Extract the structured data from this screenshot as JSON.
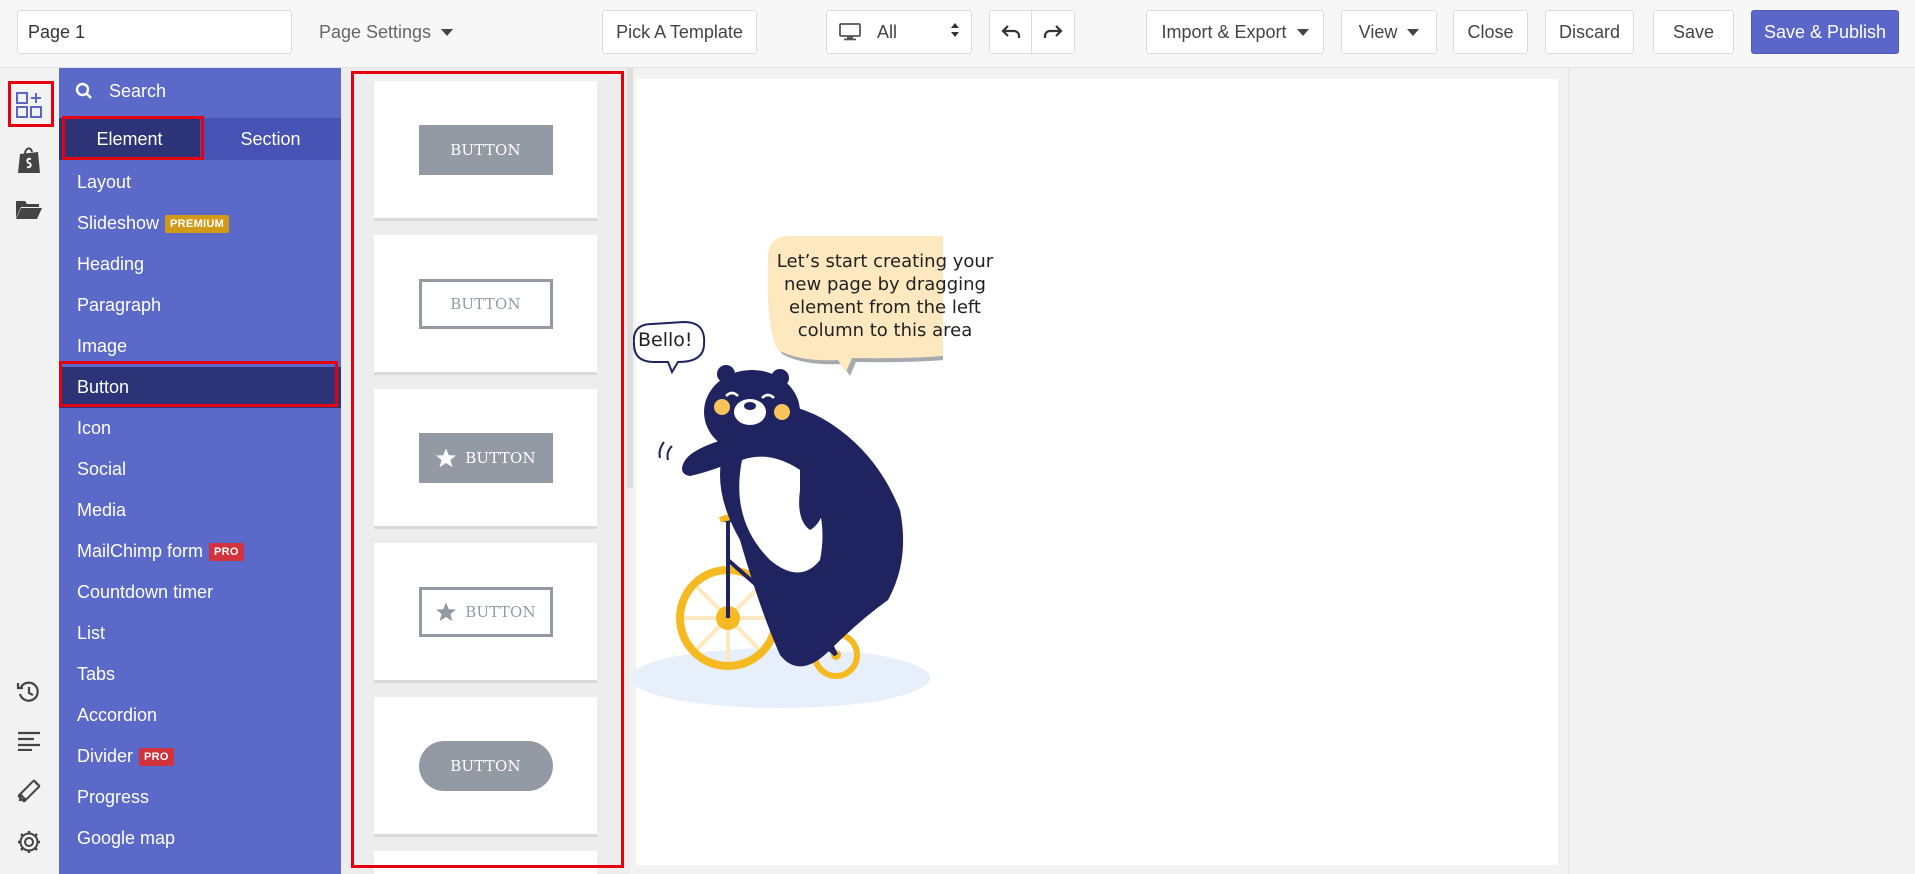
{
  "topbar": {
    "page_name": "Page 1",
    "page_settings": "Page Settings",
    "pick_template": "Pick A Template",
    "device_value": "All",
    "import_export": "Import & Export",
    "view": "View",
    "close": "Close",
    "discard": "Discard",
    "save": "Save",
    "save_publish": "Save & Publish"
  },
  "rail": {
    "icons": [
      "add-element-icon",
      "shopify-bag-icon",
      "folder-icon",
      "history-icon",
      "text-align-icon",
      "design-tools-icon",
      "settings-gear-icon"
    ]
  },
  "panel": {
    "search_placeholder": "Search",
    "tabs": [
      "Element",
      "Section"
    ],
    "active_tab": "Element",
    "items": [
      {
        "label": "Layout",
        "badge": ""
      },
      {
        "label": "Slideshow",
        "badge": "PREMIUM"
      },
      {
        "label": "Heading",
        "badge": ""
      },
      {
        "label": "Paragraph",
        "badge": ""
      },
      {
        "label": "Image",
        "badge": ""
      },
      {
        "label": "Button",
        "badge": ""
      },
      {
        "label": "Icon",
        "badge": ""
      },
      {
        "label": "Social",
        "badge": ""
      },
      {
        "label": "Media",
        "badge": ""
      },
      {
        "label": "MailChimp form",
        "badge": "PRO"
      },
      {
        "label": "Countdown timer",
        "badge": ""
      },
      {
        "label": "List",
        "badge": ""
      },
      {
        "label": "Tabs",
        "badge": ""
      },
      {
        "label": "Accordion",
        "badge": ""
      },
      {
        "label": "Divider",
        "badge": "PRO"
      },
      {
        "label": "Progress",
        "badge": ""
      },
      {
        "label": "Google map",
        "badge": ""
      }
    ],
    "selected_item": "Button"
  },
  "previews": {
    "buttons": [
      {
        "label": "BUTTON",
        "style": "solid",
        "icon": ""
      },
      {
        "label": "BUTTON",
        "style": "outline",
        "icon": ""
      },
      {
        "label": "BUTTON",
        "style": "solid",
        "icon": "star-icon"
      },
      {
        "label": "BUTTON",
        "style": "outline",
        "icon": "star-icon"
      },
      {
        "label": "BUTTON",
        "style": "pill",
        "icon": ""
      }
    ]
  },
  "canvas": {
    "bubble_text": "Let’s start creating your new page by dragging element from the left column to this area",
    "bello": "Bello!"
  },
  "colors": {
    "panel": "#5b69c8",
    "panel_selected": "#2c3477",
    "publish": "#5a67c9",
    "highlight": "#e5000f",
    "preview_button": "#939aa4",
    "bear": "#1f2461",
    "bike": "#f5b921",
    "bubble": "#fde8bf"
  }
}
